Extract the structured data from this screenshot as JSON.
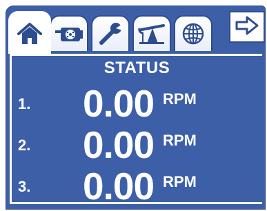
{
  "tabs": [
    {
      "name": "home-icon",
      "active": true
    },
    {
      "name": "pump-icon",
      "active": false
    },
    {
      "name": "wrench-icon",
      "active": false
    },
    {
      "name": "pumpjack-icon",
      "active": false
    },
    {
      "name": "globe-icon",
      "active": false
    }
  ],
  "nav": {
    "icon": "arrow-right-icon"
  },
  "status": {
    "title": "STATUS",
    "rows": [
      {
        "index": "1.",
        "value": "0.00",
        "unit": "RPM"
      },
      {
        "index": "2.",
        "value": "0.00",
        "unit": "RPM"
      },
      {
        "index": "3.",
        "value": "0.00",
        "unit": "RPM"
      }
    ]
  },
  "colors": {
    "background": "#3c5fa8",
    "foreground": "#ffffff",
    "tab": "#ffffff"
  }
}
